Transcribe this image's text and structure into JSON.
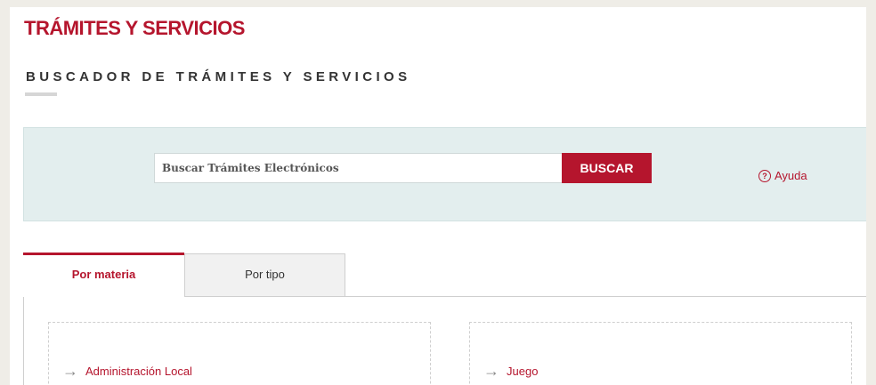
{
  "header": {
    "title": "TRÁMITES Y SERVICIOS",
    "section_title": "BUSCADOR DE TRÁMITES Y SERVICIOS"
  },
  "search": {
    "placeholder": "Buscar Trámites Electrónicos",
    "button_label": "BUSCAR",
    "help_label": "Ayuda",
    "help_icon": "?"
  },
  "tabs": [
    {
      "label": "Por materia",
      "active": true
    },
    {
      "label": "Por tipo",
      "active": false
    }
  ],
  "categories": [
    {
      "label": "Administración Local",
      "icon": "→"
    },
    {
      "label": "Juego",
      "icon": "→"
    }
  ],
  "colors": {
    "accent": "#b5152d",
    "search_band": "#e3eeee",
    "background": "#efede7"
  }
}
